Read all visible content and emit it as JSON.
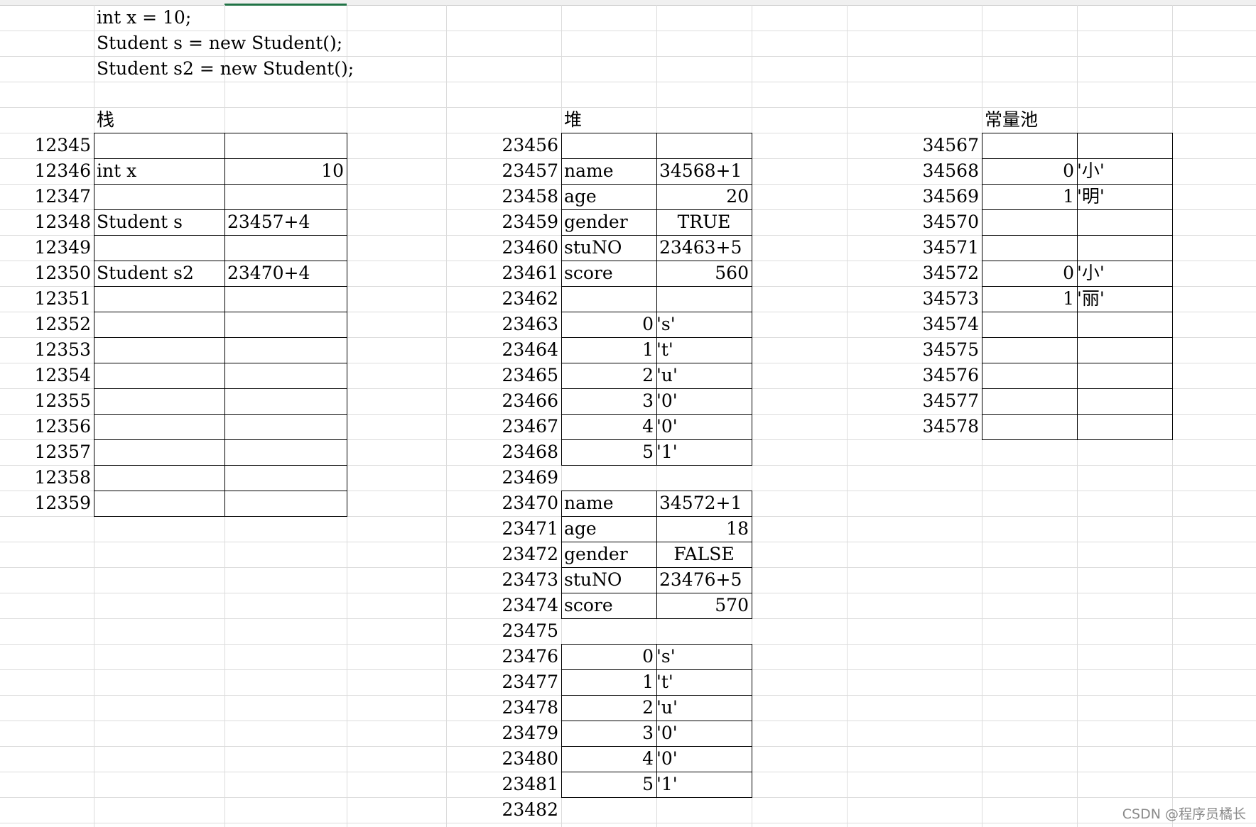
{
  "code_lines": [
    "int x = 10;",
    "Student s = new Student();",
    "Student s2 = new Student();"
  ],
  "stack": {
    "title": "栈",
    "rows": [
      {
        "addr": "12345",
        "label": "",
        "value": ""
      },
      {
        "addr": "12346",
        "label": "int x",
        "value": "10"
      },
      {
        "addr": "12347",
        "label": "",
        "value": ""
      },
      {
        "addr": "12348",
        "label": "Student s",
        "value": "23457+4"
      },
      {
        "addr": "12349",
        "label": "",
        "value": ""
      },
      {
        "addr": "12350",
        "label": "Student s2",
        "value": "23470+4"
      },
      {
        "addr": "12351",
        "label": "",
        "value": ""
      },
      {
        "addr": "12352",
        "label": "",
        "value": ""
      },
      {
        "addr": "12353",
        "label": "",
        "value": ""
      },
      {
        "addr": "12354",
        "label": "",
        "value": ""
      },
      {
        "addr": "12355",
        "label": "",
        "value": ""
      },
      {
        "addr": "12356",
        "label": "",
        "value": ""
      },
      {
        "addr": "12357",
        "label": "",
        "value": ""
      },
      {
        "addr": "12358",
        "label": "",
        "value": ""
      },
      {
        "addr": "12359",
        "label": "",
        "value": ""
      }
    ]
  },
  "heap": {
    "title": "堆",
    "rows": [
      {
        "addr": "23456",
        "left": "",
        "right": ""
      },
      {
        "addr": "23457",
        "left": "name",
        "right": "34568+1"
      },
      {
        "addr": "23458",
        "left": "age",
        "right": "20"
      },
      {
        "addr": "23459",
        "left": "gender",
        "right": "TRUE"
      },
      {
        "addr": "23460",
        "left": "stuNO",
        "right": "23463+5"
      },
      {
        "addr": "23461",
        "left": "score",
        "right": "560"
      },
      {
        "addr": "23462",
        "left": "",
        "right": ""
      },
      {
        "addr": "23463",
        "left": "0",
        "right": "'s'"
      },
      {
        "addr": "23464",
        "left": "1",
        "right": "'t'"
      },
      {
        "addr": "23465",
        "left": "2",
        "right": "'u'"
      },
      {
        "addr": "23466",
        "left": "3",
        "right": "'0'"
      },
      {
        "addr": "23467",
        "left": "4",
        "right": "'0'"
      },
      {
        "addr": "23468",
        "left": "5",
        "right": "'1'"
      },
      {
        "addr": "23469",
        "left": "",
        "right": ""
      },
      {
        "addr": "23470",
        "left": "name",
        "right": "34572+1"
      },
      {
        "addr": "23471",
        "left": "age",
        "right": "18"
      },
      {
        "addr": "23472",
        "left": "gender",
        "right": "FALSE"
      },
      {
        "addr": "23473",
        "left": "stuNO",
        "right": "23476+5"
      },
      {
        "addr": "23474",
        "left": "score",
        "right": "570"
      },
      {
        "addr": "23475",
        "left": "",
        "right": ""
      },
      {
        "addr": "23476",
        "left": "0",
        "right": "'s'"
      },
      {
        "addr": "23477",
        "left": "1",
        "right": "'t'"
      },
      {
        "addr": "23478",
        "left": "2",
        "right": "'u'"
      },
      {
        "addr": "23479",
        "left": "3",
        "right": "'0'"
      },
      {
        "addr": "23480",
        "left": "4",
        "right": "'0'"
      },
      {
        "addr": "23481",
        "left": "5",
        "right": "'1'"
      },
      {
        "addr": "23482",
        "left": "",
        "right": ""
      }
    ]
  },
  "pool": {
    "title": "常量池",
    "rows": [
      {
        "addr": "34567",
        "index": "",
        "char": ""
      },
      {
        "addr": "34568",
        "index": "0",
        "char": "'小'"
      },
      {
        "addr": "34569",
        "index": "1",
        "char": "'明'"
      },
      {
        "addr": "34570",
        "index": "",
        "char": ""
      },
      {
        "addr": "34571",
        "index": "",
        "char": ""
      },
      {
        "addr": "34572",
        "index": "0",
        "char": "'小'"
      },
      {
        "addr": "34573",
        "index": "1",
        "char": "'丽'"
      },
      {
        "addr": "34574",
        "index": "",
        "char": ""
      },
      {
        "addr": "34575",
        "index": "",
        "char": ""
      },
      {
        "addr": "34576",
        "index": "",
        "char": ""
      },
      {
        "addr": "34577",
        "index": "",
        "char": ""
      },
      {
        "addr": "34578",
        "index": "",
        "char": ""
      }
    ]
  },
  "watermark": "CSDN @程序员橘长",
  "colors": {
    "grid": "#dcdcdc",
    "border": "#000000",
    "selection": "#217346",
    "watermark": "#8a8a8a"
  }
}
